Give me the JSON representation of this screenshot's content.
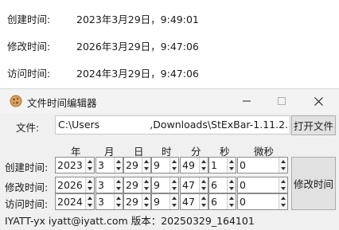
{
  "properties": {
    "rows": [
      {
        "label": "创建时间:",
        "value": "2023年3月29日，9:49:01"
      },
      {
        "label": "修改时间:",
        "value": "2026年3月29日，9:47:06"
      },
      {
        "label": "访问时间:",
        "value": "2024年3月29日，9:47:06"
      }
    ]
  },
  "window": {
    "title": "文件时间编辑器",
    "icon": "cookie-icon",
    "file_label": "文件:",
    "path_left": "C:\\Users",
    "path_right": ",Downloads\\StExBar-1.11.2.",
    "open_button": "打开文件",
    "modify_button": "修改时间",
    "columns": [
      "年",
      "月",
      "日",
      "时",
      "分",
      "秒",
      "微秒"
    ],
    "rows": [
      {
        "label": "创建时间:",
        "values": [
          "2023",
          "3",
          "29",
          "9",
          "49",
          "1",
          "0"
        ]
      },
      {
        "label": "修改时间:",
        "values": [
          "2026",
          "3",
          "29",
          "9",
          "47",
          "6",
          "0"
        ]
      },
      {
        "label": "访问时间:",
        "values": [
          "2024",
          "3",
          "29",
          "9",
          "47",
          "6",
          "0"
        ]
      }
    ],
    "footer": "IYATT-yx iyatt@iyatt.com 版本：20250329_164101"
  }
}
